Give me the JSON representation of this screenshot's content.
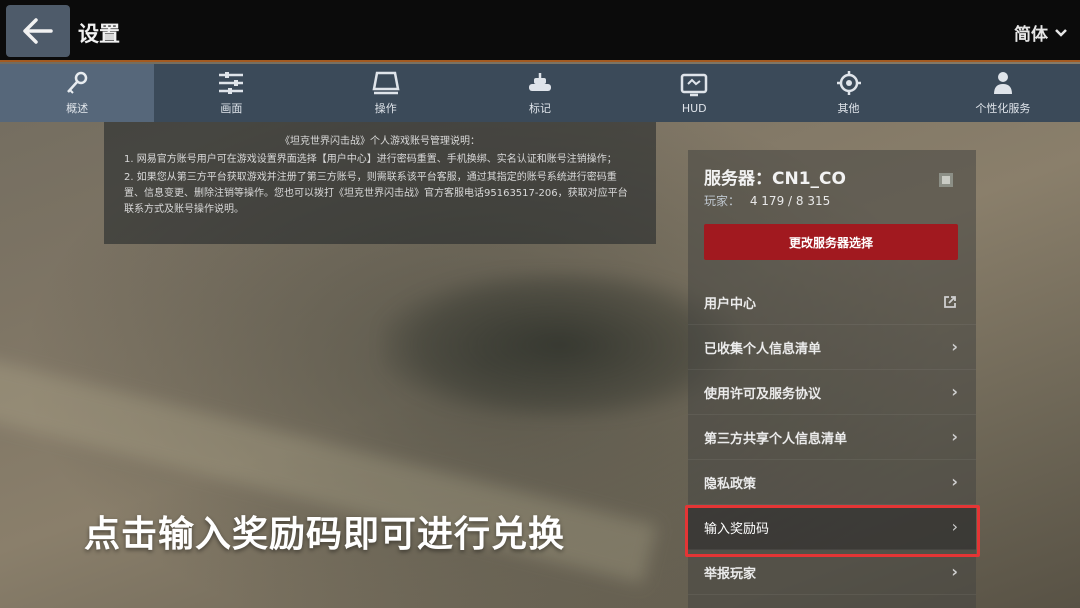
{
  "header": {
    "title": "设置",
    "language": "简体"
  },
  "tabs": [
    {
      "label": "概述",
      "icon": "key-icon",
      "active": true
    },
    {
      "label": "画面",
      "icon": "sliders-icon",
      "active": false
    },
    {
      "label": "操作",
      "icon": "monitor-icon",
      "active": false
    },
    {
      "label": "标记",
      "icon": "tank-icon",
      "active": false
    },
    {
      "label": "HUD",
      "icon": "hud-icon",
      "active": false
    },
    {
      "label": "其他",
      "icon": "gear-icon",
      "active": false
    },
    {
      "label": "个性化服务",
      "icon": "user-icon",
      "active": false
    }
  ],
  "notice": {
    "title": "《坦克世界闪击战》个人游戏账号管理说明：",
    "line1": "1. 网易官方账号用户可在游戏设置界面选择【用户中心】进行密码重置、手机换绑、实名认证和账号注销操作；",
    "line2": "2. 如果您从第三方平台获取游戏并注册了第三方账号，则需联系该平台客服，通过其指定的账号系统进行密码重置、信息变更、删除注销等操作。您也可以拨打《坦克世界闪击战》官方客服电话95163517-206，获取对应平台联系方式及账号操作说明。"
  },
  "server": {
    "name": "服务器：CN1_CO",
    "online_label": "玩家：",
    "online_value": "4 179 / 8 315",
    "switch_label": "更改服务器选择"
  },
  "menu": [
    {
      "label": "用户中心",
      "icon": "external-link-icon"
    },
    {
      "label": "已收集个人信息清单",
      "icon": "chevron-right-icon"
    },
    {
      "label": "使用许可及服务协议",
      "icon": "chevron-right-icon"
    },
    {
      "label": "第三方共享个人信息清单",
      "icon": "chevron-right-icon"
    },
    {
      "label": "隐私政策",
      "icon": "chevron-right-icon"
    },
    {
      "label": "输入奖励码",
      "icon": "chevron-right-icon"
    },
    {
      "label": "举报玩家",
      "icon": "chevron-right-icon"
    }
  ],
  "caption": "点击输入奖励码即可进行兑换",
  "colors": {
    "topbar": "#0b0b0b",
    "accent_line": "#a35a21",
    "tab_bg": "#3b4a59",
    "tab_active": "#56677a",
    "switch_button": "#a1191f",
    "highlight_border": "#e43535"
  }
}
